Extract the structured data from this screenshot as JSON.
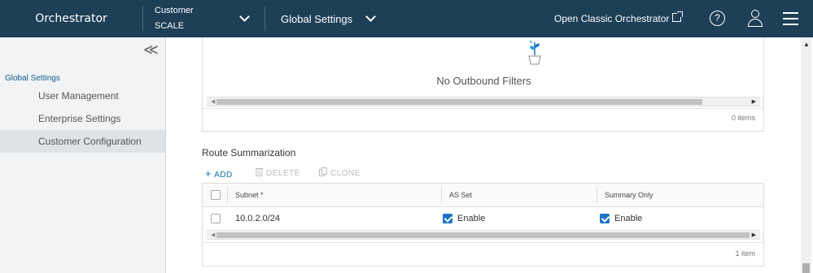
{
  "header": {
    "app_title": "Orchestrator",
    "customer_label": "Customer",
    "customer_value": "SCALE",
    "global_settings_label": "Global Settings",
    "classic_link": "Open Classic Orchestrator",
    "help_glyph": "?",
    "icons": [
      "chevron-down-icon",
      "external-link-icon",
      "help-icon",
      "user-icon",
      "menu-icon"
    ]
  },
  "sidebar": {
    "collapse_glyph": "≪",
    "section": "Global Settings",
    "items": [
      {
        "label": "User Management",
        "active": false
      },
      {
        "label": "Enterprise Settings",
        "active": false
      },
      {
        "label": "Customer Configuration",
        "active": true
      }
    ]
  },
  "outbound": {
    "empty_text": "No Outbound Filters",
    "count_text": "0 items"
  },
  "route_summarization": {
    "title": "Route Summarization",
    "actions": {
      "add": "ADD",
      "delete": "DELETE",
      "clone": "CLONE",
      "add_glyph": "+"
    },
    "columns": [
      "Subnet *",
      "AS Set",
      "Summary Only"
    ],
    "rows": [
      {
        "subnet": "10.0.2.0/24",
        "as_set": "Enable",
        "as_set_checked": true,
        "summary_only": "Enable",
        "summary_only_checked": true
      }
    ],
    "count_text": "1 item"
  },
  "colors": {
    "header_bg": "#1d3f57",
    "accent": "#0f6fb0",
    "checkbox": "#1a73c7",
    "sidebar_bg": "#f2f3f4"
  }
}
